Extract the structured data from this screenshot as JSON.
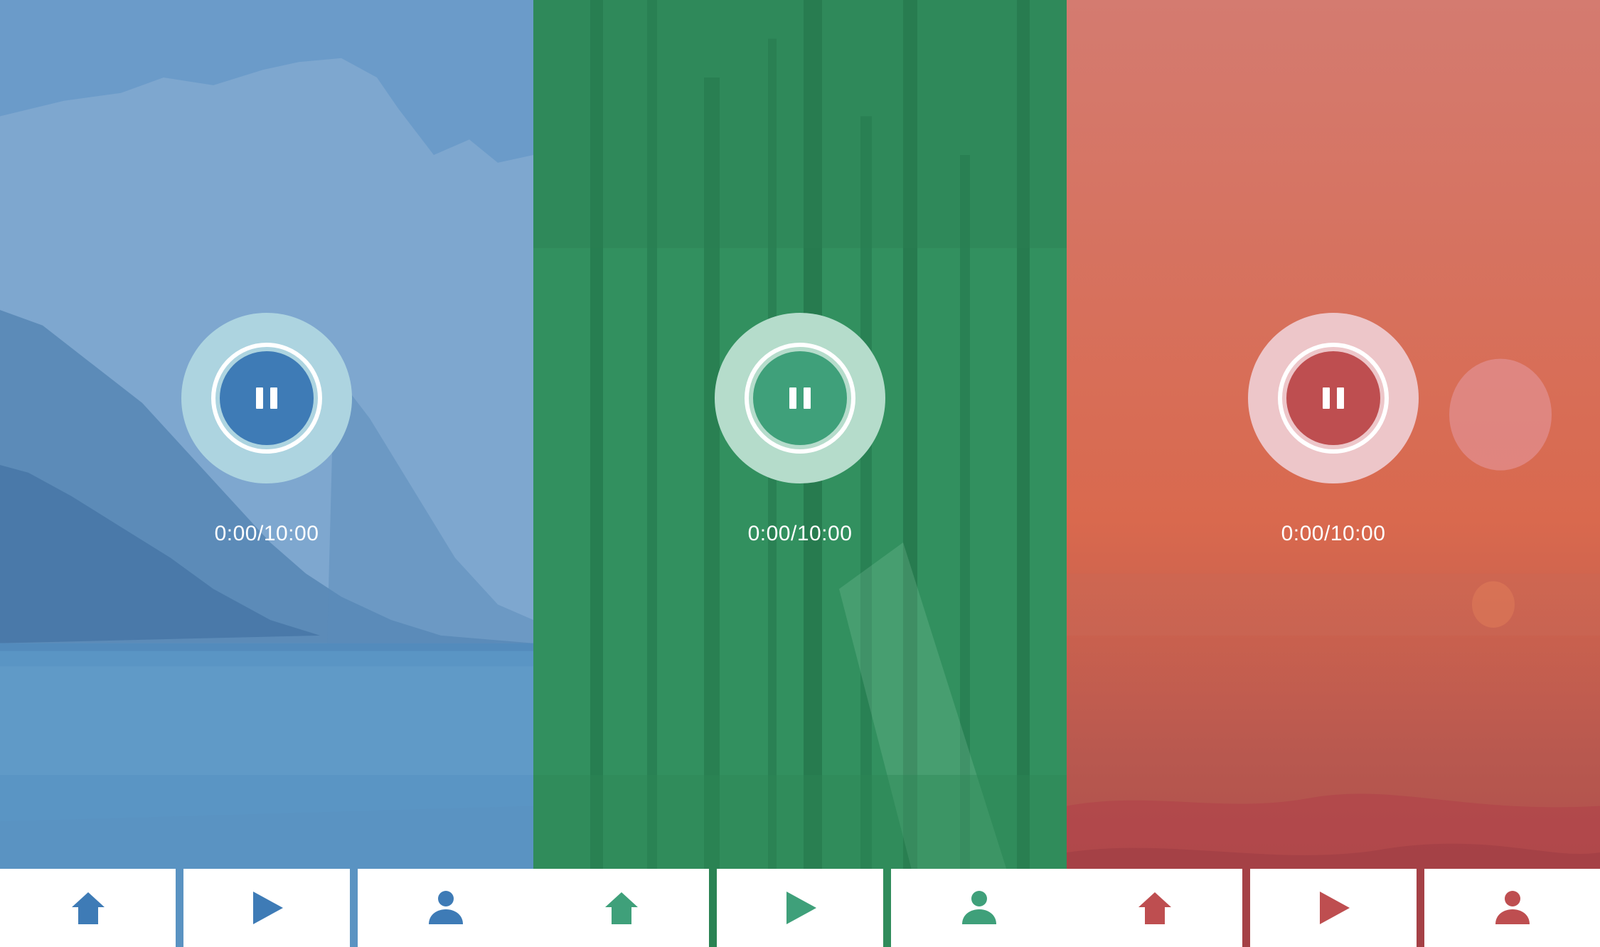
{
  "panels": [
    {
      "theme": "mountain-lake",
      "accent": "#3E7BB6",
      "ring_color": "#ADD4E0",
      "overlay_color": "#6A9ACB",
      "time": "0:00/10:00",
      "nav": [
        {
          "icon": "home-icon"
        },
        {
          "icon": "play-icon"
        },
        {
          "icon": "user-icon"
        }
      ]
    },
    {
      "theme": "forest",
      "accent": "#3FA07A",
      "ring_color": "#B5DCCB",
      "overlay_color": "#2E8A5A",
      "time": "0:00/10:00",
      "nav": [
        {
          "icon": "home-icon"
        },
        {
          "icon": "play-icon"
        },
        {
          "icon": "user-icon"
        }
      ]
    },
    {
      "theme": "sunset-sea",
      "accent": "#BE4E50",
      "ring_color": "#EDC6C9",
      "overlay_color": "#D46A55",
      "time": "0:00/10:00",
      "nav": [
        {
          "icon": "home-icon"
        },
        {
          "icon": "play-icon"
        },
        {
          "icon": "user-icon"
        }
      ]
    }
  ]
}
